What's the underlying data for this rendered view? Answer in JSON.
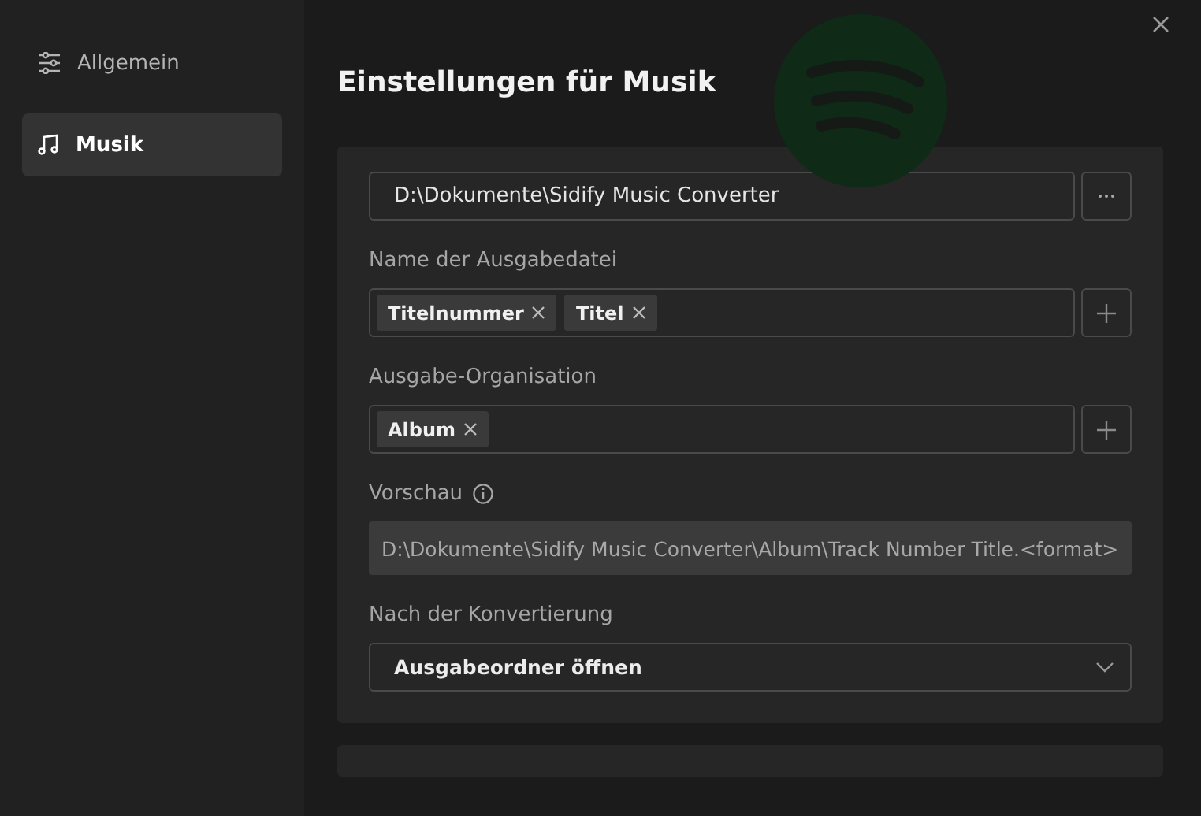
{
  "sidebar": {
    "items": [
      {
        "label": "Allgemein",
        "selected": false,
        "kind": "sliders"
      },
      {
        "label": "Musik",
        "selected": true,
        "kind": "music"
      }
    ]
  },
  "dialog": {
    "title": "Einstellungen für Musik"
  },
  "output_folder": {
    "value": "D:\\Dokumente\\Sidify Music Converter"
  },
  "file_name": {
    "label": "Name der Ausgabedatei",
    "tags": [
      "Titelnummer",
      "Titel"
    ]
  },
  "organisation": {
    "label": "Ausgabe-Organisation",
    "tags": [
      "Album"
    ]
  },
  "preview": {
    "label": "Vorschau",
    "value": "D:\\Dokumente\\Sidify Music Converter\\Album\\Track Number Title.<format>"
  },
  "after_conversion": {
    "label": "Nach der Konvertierung",
    "value": "Ausgabeordner öffnen"
  }
}
